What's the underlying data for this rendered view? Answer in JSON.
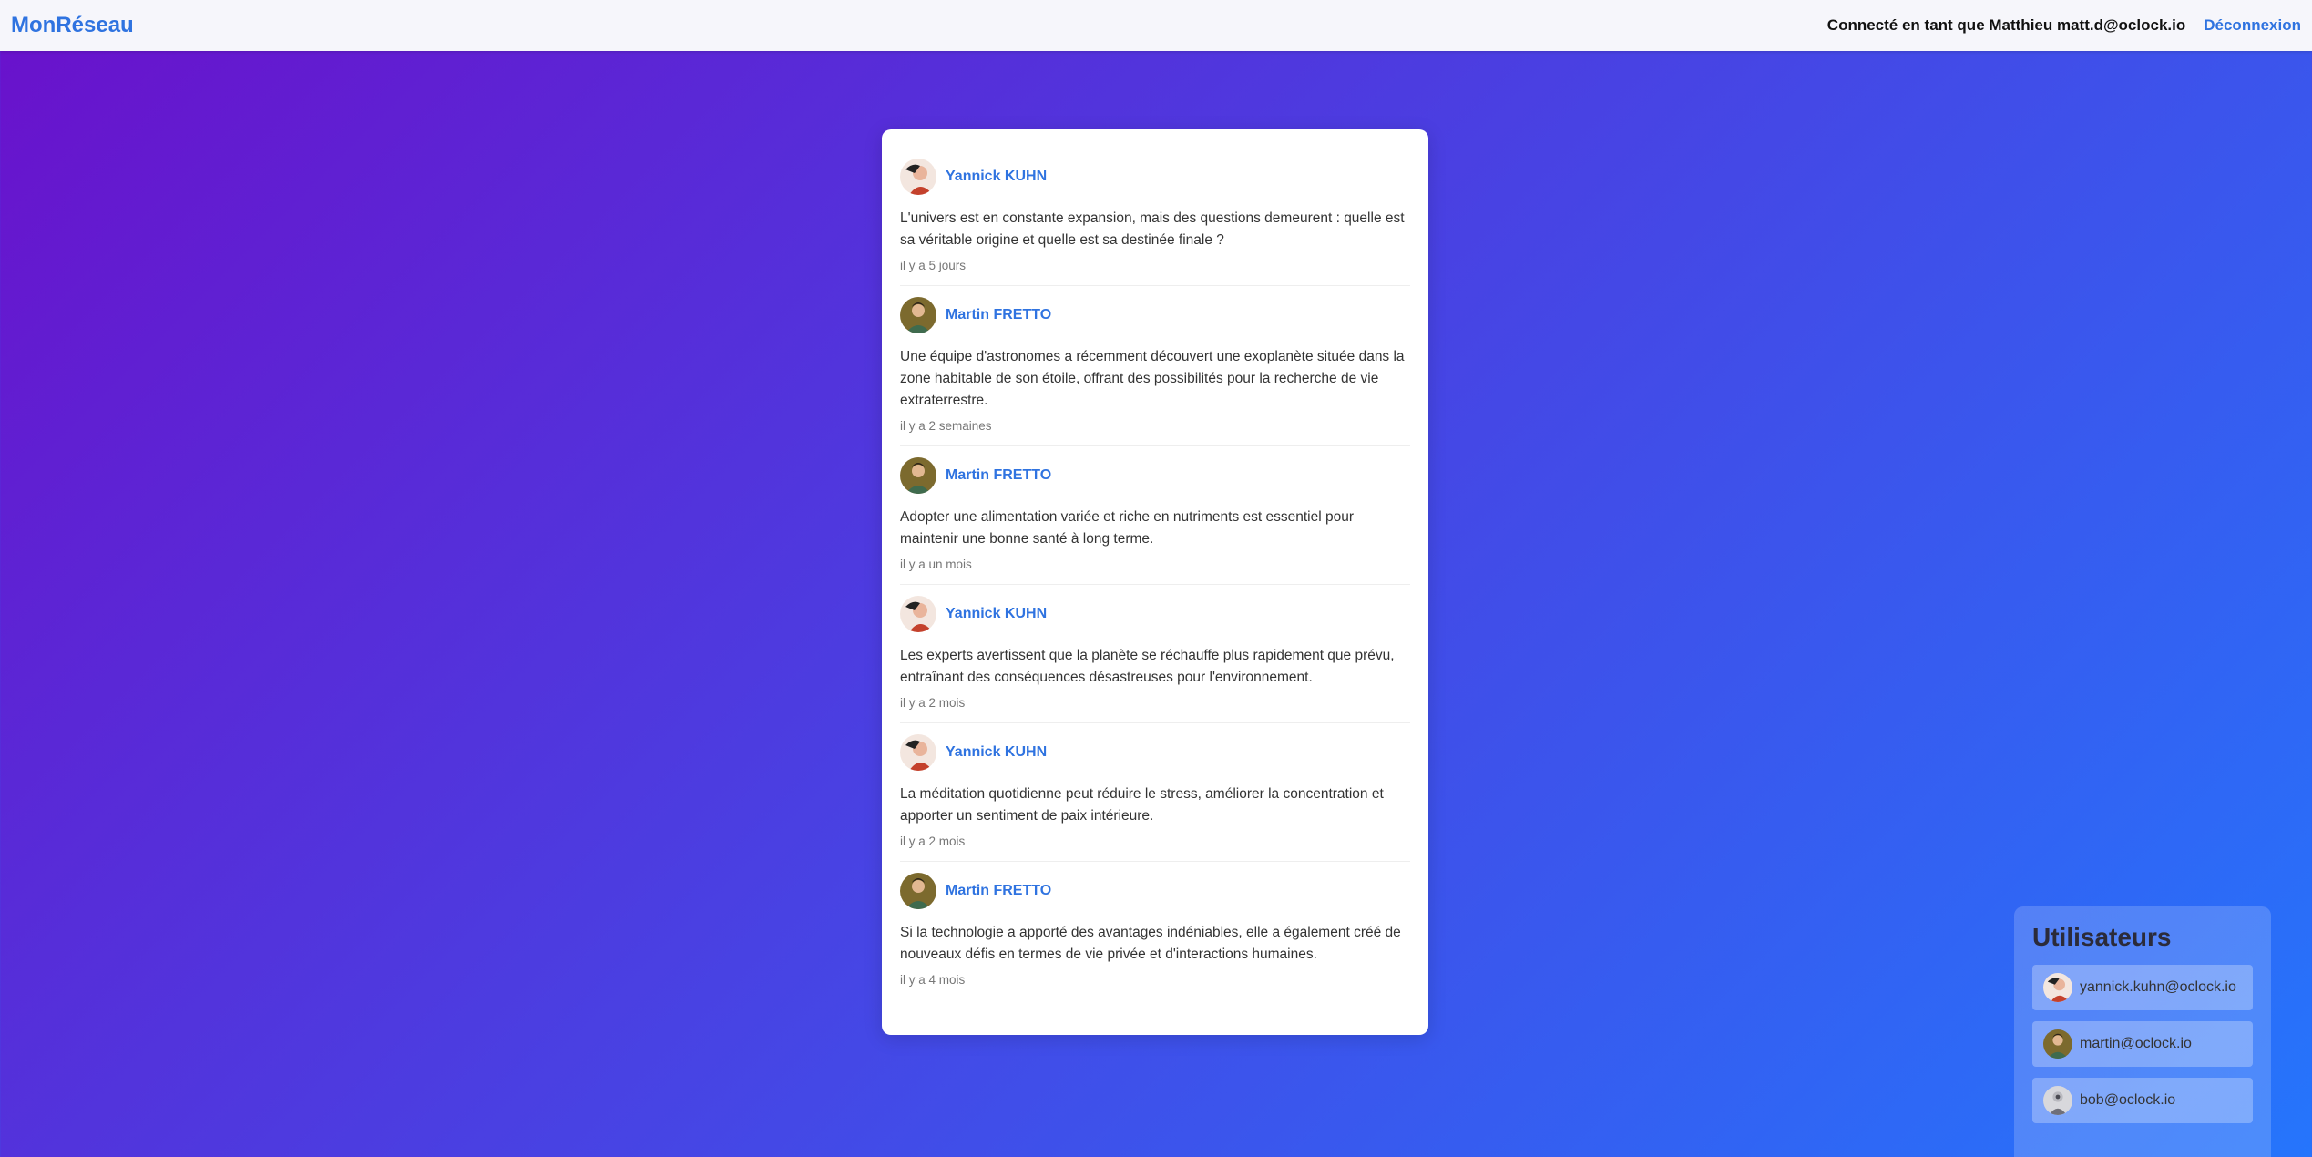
{
  "header": {
    "brand": "MonRéseau",
    "connected_text": "Connecté en tant que Matthieu matt.d@oclock.io",
    "logout_label": "Déconnexion"
  },
  "posts": [
    {
      "author": "Yannick KUHN",
      "text": "L'univers est en constante expansion, mais des questions demeurent : quelle est sa véritable origine et quelle est sa destinée finale ?",
      "time": "il y a 5 jours",
      "avatar": "yannick"
    },
    {
      "author": "Martin FRETTO",
      "text": "Une équipe d'astronomes a récemment découvert une exoplanète située dans la zone habitable de son étoile, offrant des possibilités pour la recherche de vie extraterrestre.",
      "time": "il y a 2 semaines",
      "avatar": "martin"
    },
    {
      "author": "Martin FRETTO",
      "text": "Adopter une alimentation variée et riche en nutriments est essentiel pour maintenir une bonne santé à long terme.",
      "time": "il y a un mois",
      "avatar": "martin"
    },
    {
      "author": "Yannick KUHN",
      "text": "Les experts avertissent que la planète se réchauffe plus rapidement que prévu, entraînant des conséquences désastreuses pour l'environnement.",
      "time": "il y a 2 mois",
      "avatar": "yannick"
    },
    {
      "author": "Yannick KUHN",
      "text": "La méditation quotidienne peut réduire le stress, améliorer la concentration et apporter un sentiment de paix intérieure.",
      "time": "il y a 2 mois",
      "avatar": "yannick"
    },
    {
      "author": "Martin FRETTO",
      "text": "Si la technologie a apporté des avantages indéniables, elle a également créé de nouveaux défis en termes de vie privée et d'interactions humaines.",
      "time": "il y a 4 mois",
      "avatar": "martin"
    }
  ],
  "users_panel": {
    "title": "Utilisateurs",
    "users": [
      {
        "email": "yannick.kuhn@oclock.io",
        "avatar": "yannick"
      },
      {
        "email": "martin@oclock.io",
        "avatar": "martin"
      },
      {
        "email": "bob@oclock.io",
        "avatar": "bob"
      }
    ]
  },
  "colors": {
    "accent": "#2f73e0",
    "gradient_start": "#6a11cb",
    "gradient_end": "#2575fc"
  }
}
